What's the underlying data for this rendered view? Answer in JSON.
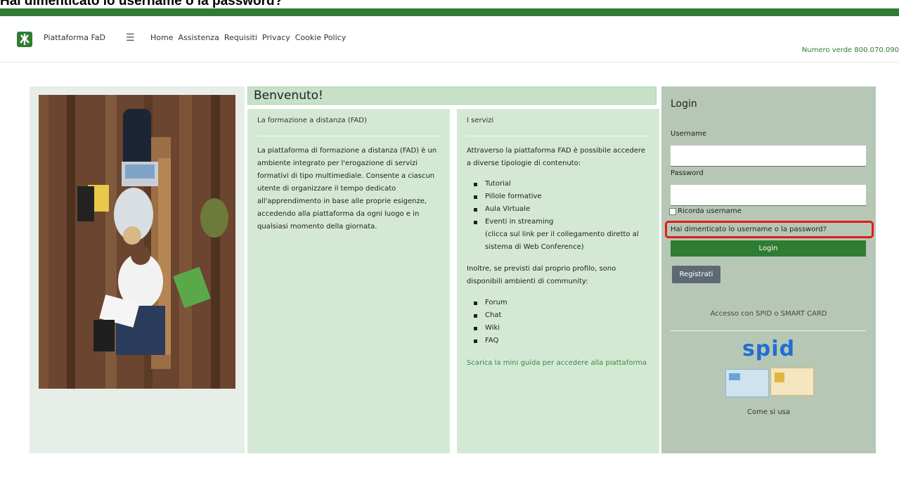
{
  "caption": "Hai dimenticato lo username o la password?",
  "nav": {
    "brand": "Piattaforma FaD",
    "menu": [
      "Home",
      "Assistenza",
      "Requisiti",
      "Privacy",
      "Cookie Policy"
    ],
    "phone": "Numero verde 800.070.090"
  },
  "welcome": {
    "title": "Benvenuto!"
  },
  "fad": {
    "title": "La formazione a distanza (FAD)",
    "text": "La piattaforma di formazione a distanza (FAD) è un ambiente integrato per l'erogazione di servizi formativi di tipo multimediale. Consente a ciascun utente di organizzare il tempo dedicato all'apprendimento in base alle proprie esigenze, accedendo alla piattaforma da ogni luogo e in qualsiasi momento della giornata."
  },
  "servizi": {
    "title": "I servizi",
    "intro": "Attraverso la piattaforma FAD è possibile accedere a diverse tipologie di contenuto:",
    "items": [
      "Tutorial",
      "Pillole formative",
      "Aula Virtuale",
      "Eventi in streaming"
    ],
    "streaming_note": "(clicca sul link per il collegamento diretto al sistema di Web Conference)",
    "community_intro": "Inoltre, se previsti dal proprio profilo, sono disponibili ambienti di community:",
    "community": [
      "Forum",
      "Chat",
      "Wiki",
      "FAQ"
    ],
    "guide_link": "Scarica la mini guida per accedere alla piattaforma"
  },
  "login": {
    "title": "Login",
    "username_label": "Username",
    "password_label": "Password",
    "remember": "Ricorda username",
    "forgot": "Hai dimenticato lo username o la password?",
    "login_button": "Login",
    "register_button": "Registrati",
    "spid_text": "Accesso con SPID o SMART CARD",
    "spid_logo": "spid",
    "how_to": "Come si usa"
  },
  "colors": {
    "brand_green": "#2e7d32",
    "panel_green": "#d4e9d4",
    "login_panel": "#b7c7b6",
    "highlight": "#e21b1b",
    "spid_blue": "#1f6fd1"
  }
}
